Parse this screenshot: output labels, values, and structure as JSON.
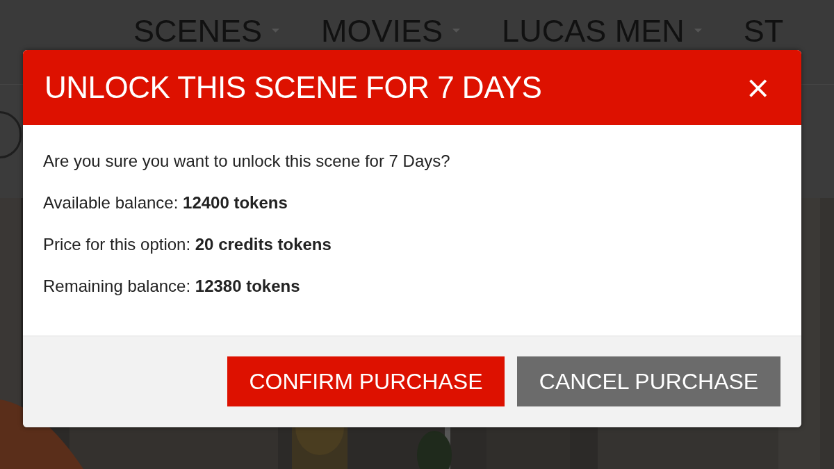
{
  "nav": {
    "items": [
      {
        "label": "SCENES",
        "dropdown": true
      },
      {
        "label": "MOVIES",
        "dropdown": true
      },
      {
        "label": "LUCAS MEN",
        "dropdown": true
      },
      {
        "label": "ST",
        "dropdown": false
      }
    ]
  },
  "dialog": {
    "title": "UNLOCK THIS SCENE FOR 7 DAYS",
    "close": "×",
    "lines": [
      "Are you sure you want to unlock this scene for 7 Days?",
      "Available balance: **12400 tokens**",
      "Price for this option: **20 credits tokens**",
      "Remaining balance: **12380 tokens**"
    ],
    "buttons": [
      {
        "label": "CONFIRM PURCHASE",
        "kind": "primary"
      },
      {
        "label": "CANCEL PURCHASE",
        "kind": "secondary"
      }
    ]
  }
}
